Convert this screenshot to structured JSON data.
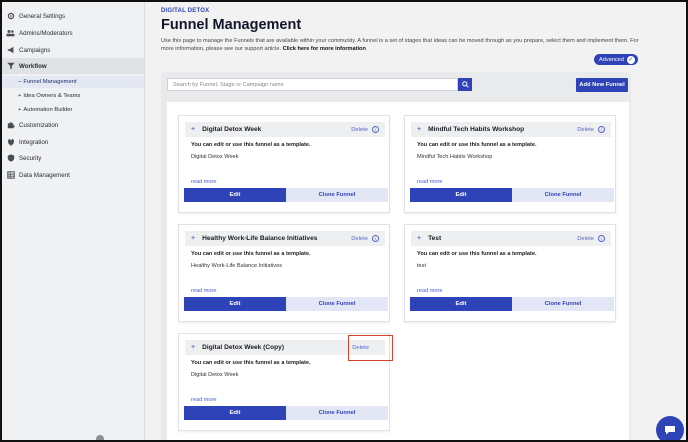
{
  "sidebar": {
    "items": [
      {
        "label": "General Settings",
        "icon": "gear-icon"
      },
      {
        "label": "Admins/Moderators",
        "icon": "users-icon"
      },
      {
        "label": "Campaigns",
        "icon": "megaphone-icon"
      },
      {
        "label": "Workflow",
        "icon": "funnel-icon"
      },
      {
        "label": "Customization",
        "icon": "puzzle-icon"
      },
      {
        "label": "Integration",
        "icon": "plug-icon"
      },
      {
        "label": "Security",
        "icon": "shield-icon"
      },
      {
        "label": "Data Management",
        "icon": "table-icon"
      }
    ],
    "subitems": [
      {
        "prefix": "−",
        "label": "Funnel Management"
      },
      {
        "prefix": "+",
        "label": "Idea Owners & Teams"
      },
      {
        "prefix": "+",
        "label": "Automation Builder"
      }
    ]
  },
  "header": {
    "eyebrow": "DIGITAL DETOX",
    "title": "Funnel Management",
    "description": "Use this page to manage the Funnels that are available within your community. A funnel is a set of stages that ideas can be moved through as you prepare, select them and implement them. For more information, please see our support article.",
    "link": "Click here for more information",
    "advanced_label": "Advanced"
  },
  "toolbar": {
    "search_placeholder": "Search by Funnel, Stage or Campaign name",
    "add_label": "Add New Funnel"
  },
  "card_labels": {
    "delete": "Delete",
    "template_note": "You can edit or use this funnel as a template.",
    "read_more": "read more",
    "edit": "Edit",
    "clone": "Clone Funnel"
  },
  "cards": [
    {
      "name": "Digital Detox Week",
      "body": "Digital Detox Week"
    },
    {
      "name": "Mindful Tech Habits Workshop",
      "body": "Mindful Tech Habits Workshop"
    },
    {
      "name": "Healthy Work-Life Balance Initiatives",
      "body": "Healthy Work-Life Balance Initiatives"
    },
    {
      "name": "Test",
      "body": "test"
    },
    {
      "name": "Digital Detox Week (Copy)",
      "body": "Digital Detox Week"
    }
  ],
  "colors": {
    "accent": "#2f43b8",
    "highlight": "#d9402b"
  }
}
